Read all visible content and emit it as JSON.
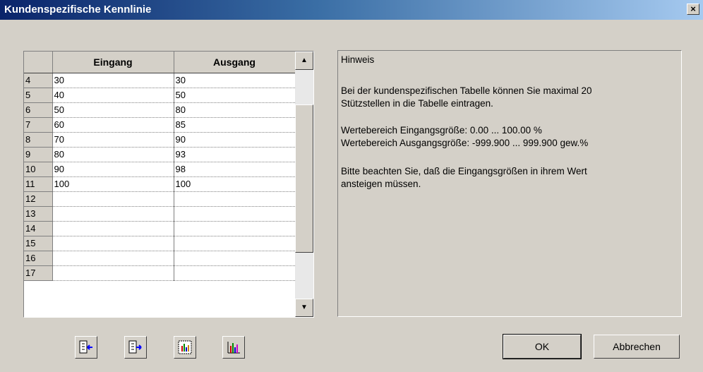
{
  "window": {
    "title": "Kundenspezifische Kennlinie",
    "close_glyph": "×"
  },
  "table": {
    "columns": [
      "Eingang",
      "Ausgang"
    ],
    "rows": [
      {
        "n": "4",
        "in": "30",
        "out": "30"
      },
      {
        "n": "5",
        "in": "40",
        "out": "50"
      },
      {
        "n": "6",
        "in": "50",
        "out": "80"
      },
      {
        "n": "7",
        "in": "60",
        "out": "85"
      },
      {
        "n": "8",
        "in": "70",
        "out": "90"
      },
      {
        "n": "9",
        "in": "80",
        "out": "93"
      },
      {
        "n": "10",
        "in": "90",
        "out": "98"
      },
      {
        "n": "11",
        "in": "100",
        "out": "100"
      },
      {
        "n": "12",
        "in": "",
        "out": ""
      },
      {
        "n": "13",
        "in": "",
        "out": ""
      },
      {
        "n": "14",
        "in": "",
        "out": ""
      },
      {
        "n": "15",
        "in": "",
        "out": ""
      },
      {
        "n": "16",
        "in": "",
        "out": ""
      },
      {
        "n": "17",
        "in": "",
        "out": ""
      }
    ]
  },
  "hint": {
    "heading": "Hinweis",
    "line1": "Bei der kundenspezifischen Tabelle können Sie maximal 20",
    "line2": "Stützstellen in die Tabelle eintragen.",
    "line3": "Wertebereich Eingangsgröße: 0.00 ... 100.00 %",
    "line4": "Wertebereich Ausgangsgröße: -999.900 ... 999.900 gew.%",
    "line5": "Bitte beachten Sie, daß die Eingangsgrößen in ihrem Wert",
    "line6": "ansteigen müssen."
  },
  "toolbar": {
    "icons": [
      "import-icon",
      "export-icon",
      "chart-view-icon",
      "bar-chart-icon"
    ]
  },
  "buttons": {
    "ok": "OK",
    "cancel": "Abbrechen"
  },
  "colors": {
    "title_start": "#0a246a",
    "title_end": "#a6caf0",
    "face": "#d4d0c8"
  }
}
